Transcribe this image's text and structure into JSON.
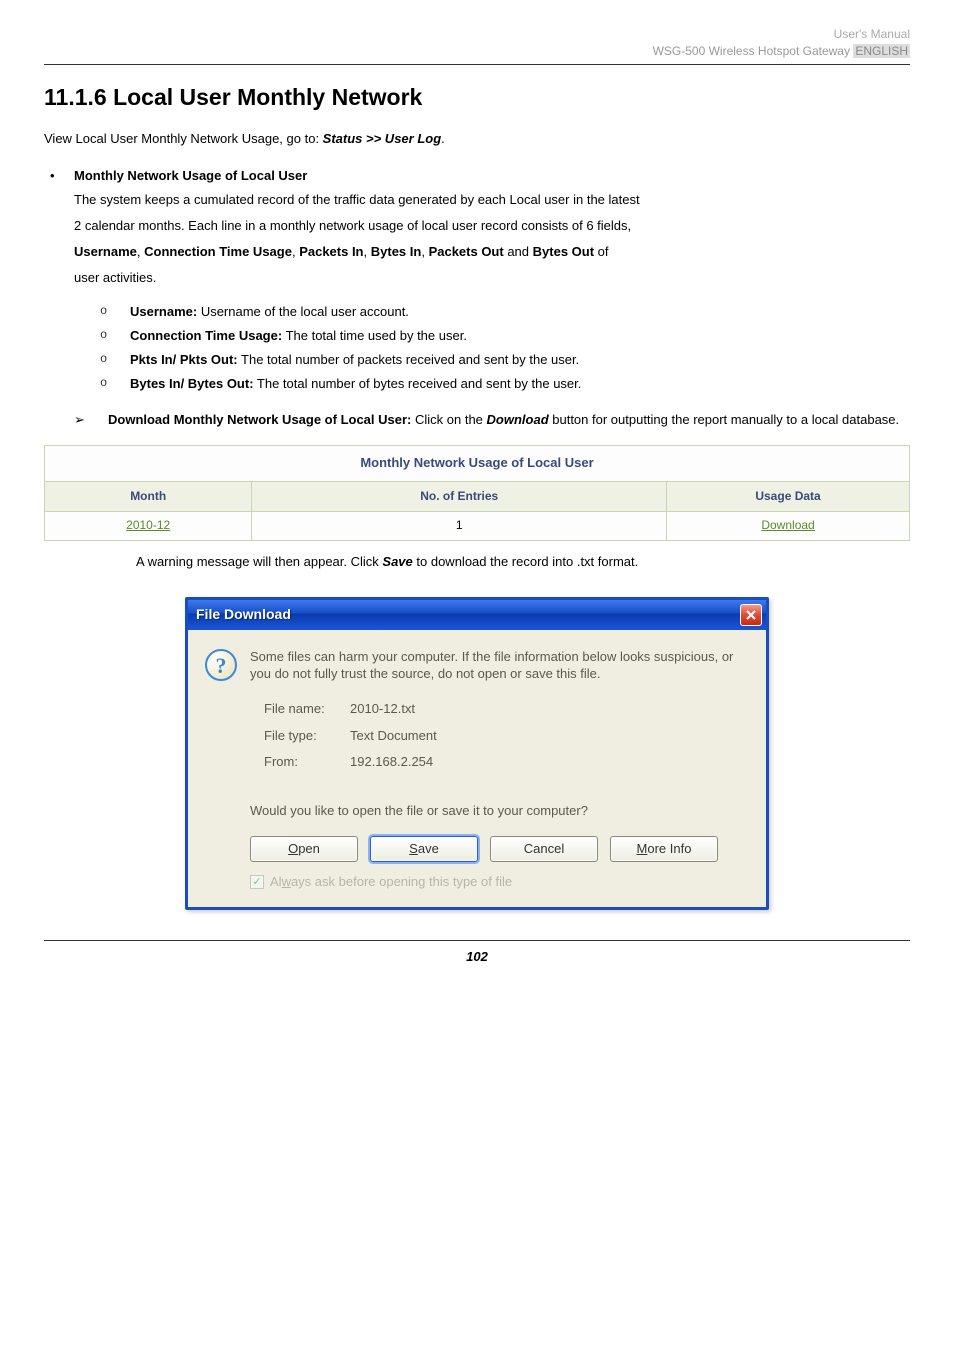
{
  "header": {
    "line1": "User's Manual",
    "line2_prefix": "WSG-500 Wireless Hotspot Gateway ",
    "line2_tag": "ENGLISH"
  },
  "section_title": "11.1.6 Local User Monthly Network",
  "intro": {
    "prefix": "View Local User Monthly Network Usage, go to: ",
    "path": "Status >> User Log",
    "suffix": "."
  },
  "bullet_title": "Monthly Network Usage of Local User",
  "para_lines": {
    "l1": "The system keeps a cumulated record of the traffic data generated by each Local user in the latest",
    "l2": "2 calendar months. Each line in a monthly network usage of local user record consists of 6 fields,",
    "l3a": "Username",
    "l3b": ", ",
    "l3c": "Connection Time Usage",
    "l3d": ", ",
    "l3e": "Packets In",
    "l3f": ", ",
    "l3g": "Bytes In",
    "l3h": ", ",
    "l3i": "Packets Out",
    "l3j": " and ",
    "l3k": "Bytes Out",
    "l3l": " of",
    "l4": "user activities."
  },
  "sublist": [
    {
      "label": "Username:",
      "text": " Username of the local user account."
    },
    {
      "label": "Connection Time Usage:",
      "text": " The total time used by the user."
    },
    {
      "label": "Pkts In/ Pkts Out:",
      "text": " The total number of packets received and sent by the user."
    },
    {
      "label": "Bytes In/ Bytes Out:",
      "text": " The total number of bytes received and sent by the user."
    }
  ],
  "arrow": {
    "label": "Download Monthly Network Usage of Local User:",
    "text1": " Click on the ",
    "kw": "Download",
    "text2": " button for outputting the report manually to a local database."
  },
  "usage_table": {
    "title": "Monthly Network Usage of Local User",
    "headers": {
      "month": "Month",
      "entries": "No. of Entries",
      "data": "Usage Data"
    },
    "row": {
      "month": "2010-12",
      "entries": "1",
      "data": "Download"
    }
  },
  "after_table": {
    "t1": "A warning message will then appear. Click ",
    "kw": "Save",
    "t2": " to download the record into .txt format."
  },
  "dialog": {
    "title": "File Download",
    "warn": "Some files can harm your computer. If the file information below looks suspicious, or you do not fully trust the source, do not open or save this file.",
    "info": {
      "filename_label": "File name:",
      "filename_value": "2010-12.txt",
      "filetype_label": "File type:",
      "filetype_value": "Text Document",
      "from_label": "From:",
      "from_value": "192.168.2.254"
    },
    "prompt": "Would you like to open the file or save it to your computer?",
    "buttons": {
      "open_u": "O",
      "open_rest": "pen",
      "save_u": "S",
      "save_rest": "ave",
      "cancel": "Cancel",
      "more_u": "M",
      "more_rest": "ore Info"
    },
    "checkbox_pre": "Al",
    "checkbox_u": "w",
    "checkbox_post": "ays ask before opening this type of file"
  },
  "footer": "102"
}
